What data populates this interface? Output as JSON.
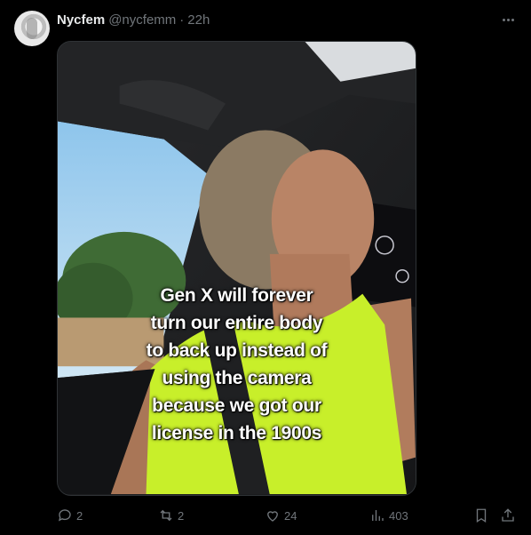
{
  "post": {
    "display_name": "Nycfem",
    "handle": "@nycfemm",
    "separator": "·",
    "time": "22h",
    "avatar_icon": "profile-avatar"
  },
  "media": {
    "caption_lines": [
      "Gen X will forever",
      "turn our entire body",
      "to back up instead of",
      "using the camera",
      "because we got our",
      "license in the 1900s"
    ]
  },
  "actions": {
    "replies": "2",
    "reposts": "2",
    "likes": "24",
    "views": "403"
  },
  "colors": {
    "background": "#000000",
    "muted": "#71767b",
    "text": "#e7e9ea"
  }
}
